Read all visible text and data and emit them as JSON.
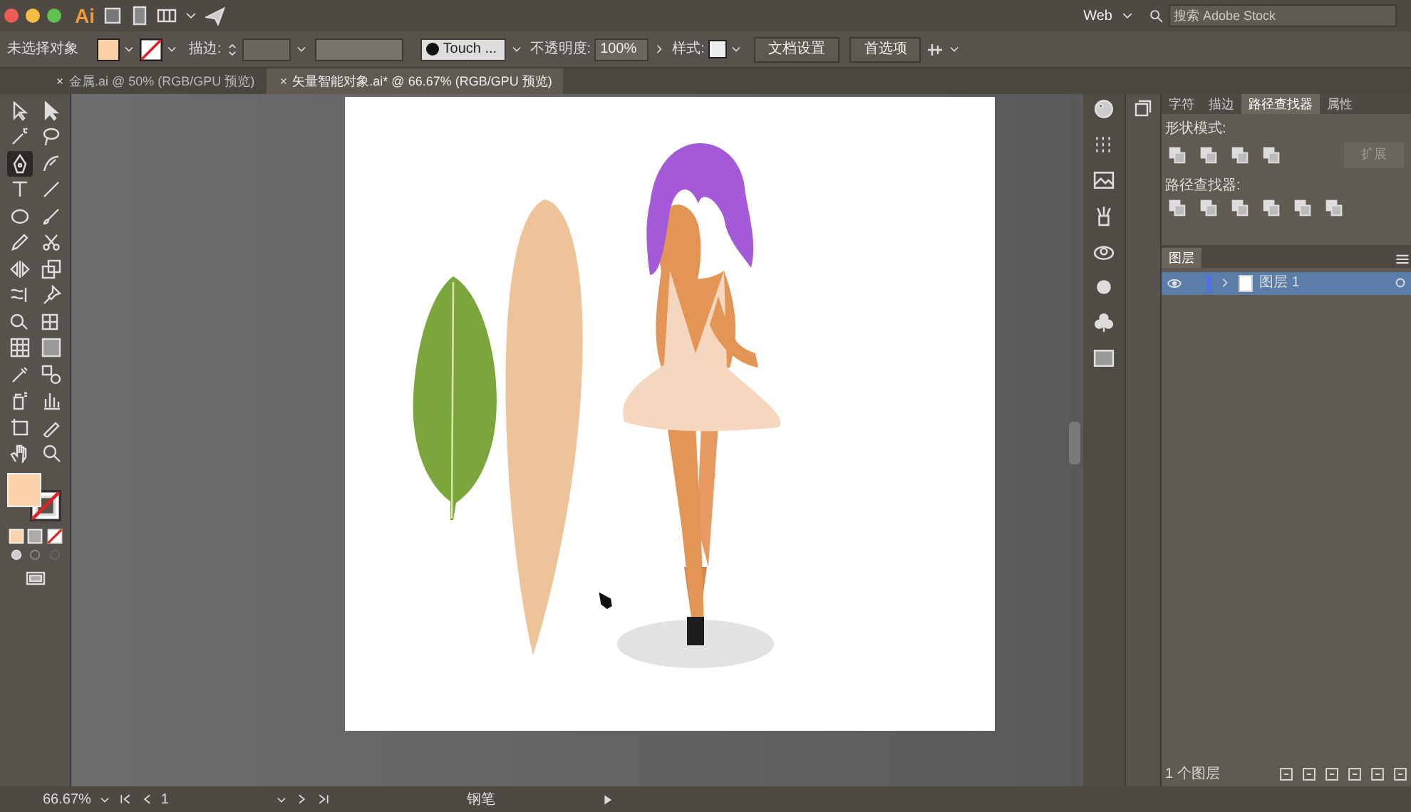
{
  "title_bar": {
    "app_logo": "Ai",
    "workspace": "Web",
    "search": {
      "placeholder": "搜索 Adobe Stock"
    }
  },
  "control_bar": {
    "selection": "未选择对象",
    "stroke_label": "描边:",
    "brush": "Touch ...",
    "opacity_label": "不透明度:",
    "opacity": "100%",
    "style_label": "样式:",
    "buttons": [
      "文档设置",
      "首选项"
    ]
  },
  "doc_tabs": [
    {
      "label": "金属.ai @ 50% (RGB/GPU 预览)",
      "selected": false
    },
    {
      "label": "矢量智能对象.ai* @ 66.67% (RGB/GPU 预览)",
      "selected": true
    }
  ],
  "tools": [
    {
      "kind": "select",
      "selected": false
    },
    {
      "kind": "direct",
      "selected": false
    },
    {
      "kind": "wand",
      "selected": false
    },
    {
      "kind": "lasso",
      "selected": false
    },
    {
      "kind": "pen",
      "selected": true
    },
    {
      "kind": "curve",
      "selected": false
    },
    {
      "kind": "type",
      "selected": false
    },
    {
      "kind": "line",
      "selected": false
    },
    {
      "kind": "ellipse",
      "selected": false
    },
    {
      "kind": "brush",
      "selected": false
    },
    {
      "kind": "pencil",
      "selected": false
    },
    {
      "kind": "scissors",
      "selected": false
    },
    {
      "kind": "reflect",
      "selected": false
    },
    {
      "kind": "scale",
      "selected": false
    },
    {
      "kind": "warp",
      "selected": false
    },
    {
      "kind": "pin",
      "selected": false
    },
    {
      "kind": "builder",
      "selected": false
    },
    {
      "kind": "perspective",
      "selected": false
    },
    {
      "kind": "mesh",
      "selected": false
    },
    {
      "kind": "gradient",
      "selected": false
    },
    {
      "kind": "eyedropper",
      "selected": false
    },
    {
      "kind": "blend",
      "selected": false
    },
    {
      "kind": "sprayer",
      "selected": false
    },
    {
      "kind": "graph",
      "selected": false
    },
    {
      "kind": "artboard",
      "selected": false
    },
    {
      "kind": "slice",
      "selected": false
    },
    {
      "kind": "hand",
      "selected": false
    },
    {
      "kind": "zoom",
      "selected": false
    }
  ],
  "panel": {
    "tabs": [
      {
        "label": "字符",
        "selected": false
      },
      {
        "label": "描边",
        "selected": false
      },
      {
        "label": "路径查找器",
        "selected": true
      },
      {
        "label": "属性",
        "selected": false
      }
    ],
    "shape_modes_label": "形状模式:",
    "expand_button": {
      "label": "扩展",
      "disabled": true
    },
    "pathfinders_label": "路径查找器:"
  },
  "layers": {
    "tab": "图层",
    "rows": [
      {
        "name": "图层 1",
        "selected": true,
        "visible": true
      }
    ],
    "count": "1 个图层"
  },
  "status_bar": {
    "zoom": "66.67%",
    "page": "1",
    "tool": "钢笔"
  }
}
